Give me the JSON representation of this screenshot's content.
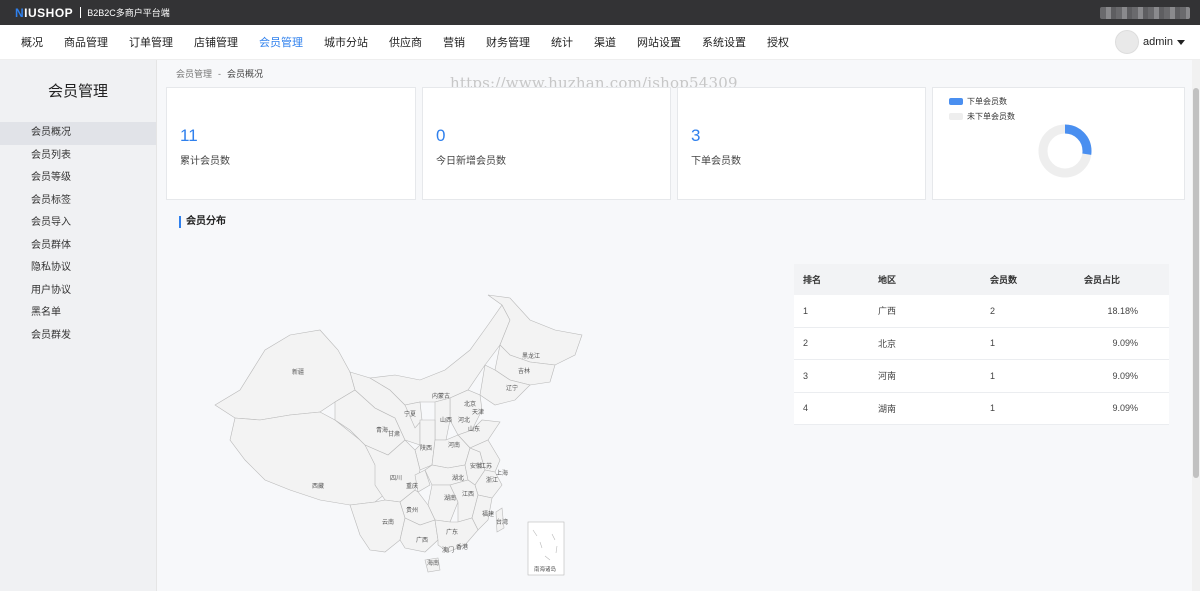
{
  "topbar": {
    "logo_lead": "N",
    "logo_rest": "IUSHOP",
    "platform": "B2B2C多商户平台端"
  },
  "nav": {
    "items": [
      "概况",
      "商品管理",
      "订单管理",
      "店铺管理",
      "会员管理",
      "城市分站",
      "供应商",
      "营销",
      "财务管理",
      "统计",
      "渠道",
      "网站设置",
      "系统设置",
      "授权"
    ],
    "active": "会员管理",
    "user": "admin"
  },
  "sidebar": {
    "title": "会员管理",
    "items": [
      "会员概况",
      "会员列表",
      "会员等级",
      "会员标签",
      "会员导入",
      "会员群体",
      "隐私协议",
      "用户协议",
      "黑名单",
      "会员群发"
    ]
  },
  "breadcrumb": {
    "parent": "会员管理",
    "sep": "-",
    "current": "会员概况"
  },
  "watermark": "https://www.huzhan.com/ishop54309",
  "stats": [
    {
      "value": "11",
      "label": "累计会员数"
    },
    {
      "value": "0",
      "label": "今日新增会员数"
    },
    {
      "value": "3",
      "label": "下单会员数"
    }
  ],
  "donut": {
    "legend": [
      "下单会员数",
      "未下单会员数"
    ],
    "colors": {
      "ordered": "#4a8ff0",
      "not_ordered": "#eeeeee"
    },
    "ordered_fraction": 0.2727
  },
  "section_title": "会员分布",
  "map": {
    "provinces": [
      "新疆",
      "西藏",
      "青海",
      "甘肃",
      "宁夏",
      "内蒙古",
      "黑龙江",
      "吉林",
      "辽宁",
      "北京",
      "天津",
      "河北",
      "山西",
      "山东",
      "陕西",
      "河南",
      "四川",
      "重庆",
      "湖北",
      "安徽",
      "江苏",
      "上海",
      "浙江",
      "湖南",
      "江西",
      "贵州",
      "云南",
      "福建",
      "台湾",
      "广西",
      "广东",
      "香港",
      "澳门",
      "海南"
    ],
    "inset": "南海诸岛"
  },
  "table": {
    "headers": [
      "排名",
      "地区",
      "会员数",
      "会员占比"
    ],
    "rows": [
      [
        "1",
        "广西",
        "2",
        "18.18%"
      ],
      [
        "2",
        "北京",
        "1",
        "9.09%"
      ],
      [
        "3",
        "河南",
        "1",
        "9.09%"
      ],
      [
        "4",
        "湖南",
        "1",
        "9.09%"
      ]
    ]
  }
}
